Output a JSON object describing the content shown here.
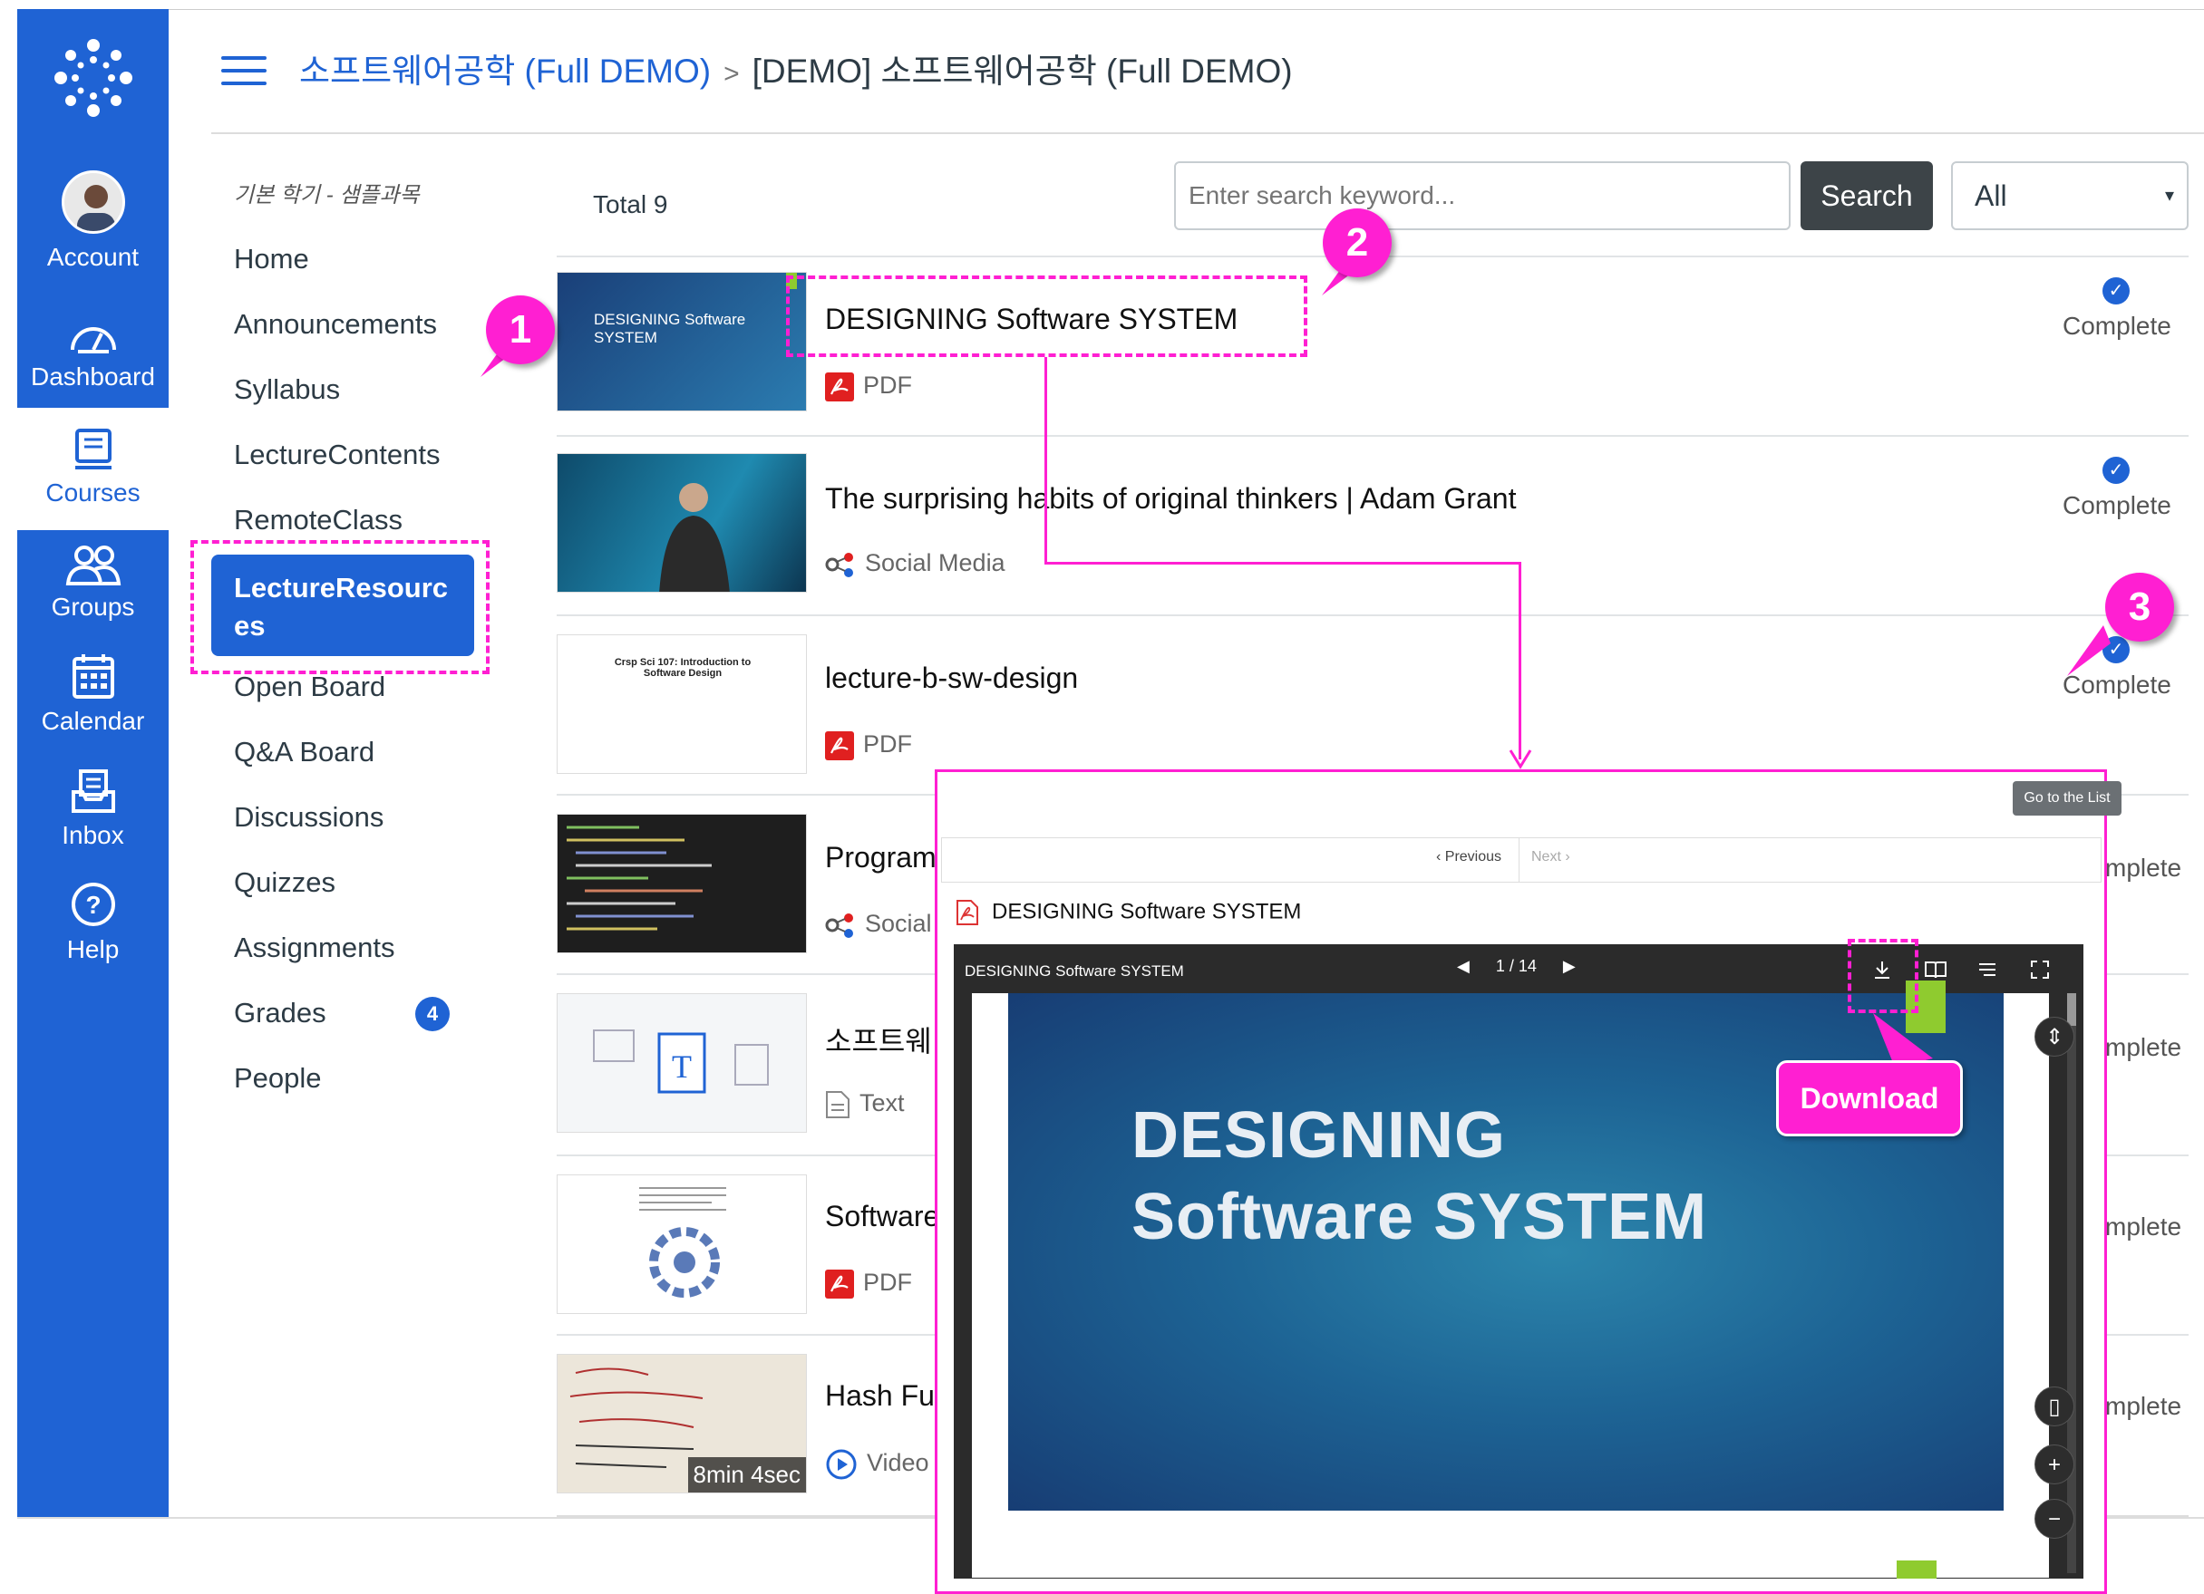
{
  "global_nav": {
    "items": [
      {
        "label": "Account",
        "icon": "avatar"
      },
      {
        "label": "Dashboard",
        "icon": "dashboard-icon"
      },
      {
        "label": "Courses",
        "icon": "courses-icon",
        "active": true
      },
      {
        "label": "Groups",
        "icon": "groups-icon"
      },
      {
        "label": "Calendar",
        "icon": "calendar-icon"
      },
      {
        "label": "Inbox",
        "icon": "inbox-icon"
      },
      {
        "label": "Help",
        "icon": "help-icon"
      }
    ],
    "bg_color": "#1f63d4"
  },
  "header": {
    "breadcrumb_course": "소프트웨어공학 (Full DEMO)",
    "breadcrumb_sep": ">",
    "breadcrumb_current": "[DEMO] 소프트웨어공학 (Full DEMO)"
  },
  "course_nav": {
    "term": "기본 학기 - 샘플과목",
    "items": [
      "Home",
      "Announcements",
      "Syllabus",
      "LectureContents",
      "RemoteClass"
    ],
    "active": "LectureResources",
    "items_after": [
      "Open Board",
      "Q&A Board",
      "Discussions",
      "Quizzes",
      "Assignments",
      "Grades",
      "People"
    ],
    "grades_badge": "4"
  },
  "toolbar": {
    "total": "Total 9",
    "search_placeholder": "Enter search keyword...",
    "search_label": "Search",
    "filter_value": "All",
    "filter_caret": "▾"
  },
  "items": [
    {
      "title": "DESIGNING Software SYSTEM",
      "type": "PDF",
      "status": "Complete",
      "thumb_text": "DESIGNING Software SYSTEM"
    },
    {
      "title": "The surprising habits of original thinkers | Adam Grant",
      "type": "Social Media",
      "status": "Complete"
    },
    {
      "title": "lecture-b-sw-design",
      "type": "PDF",
      "status": "Complete",
      "thumb_text": "Crsp Sci 107: Introduction to Software Design"
    },
    {
      "title": "Program",
      "type": "Social",
      "status": "mplete"
    },
    {
      "title": "소프트웨",
      "type": "Text",
      "status": "mplete"
    },
    {
      "title": "Software",
      "type": "PDF",
      "status": "mplete"
    },
    {
      "title": "Hash Fu",
      "type": "Video",
      "status": "mplete",
      "duration": "8min 4sec"
    }
  ],
  "annotations": {
    "n1": "1",
    "n2": "2",
    "n3": "3",
    "download": "Download",
    "color": "#ff1fd2"
  },
  "viewer": {
    "go_to_list": "Go to the List",
    "previous": "Previous",
    "next": "Next",
    "doc_title": "DESIGNING Software SYSTEM",
    "pdf_bar_title": "DESIGNING Software SYSTEM",
    "page_indicator": "1 / 14",
    "slide_line1": "DESIGNING",
    "slide_line2": "Software SYSTEM"
  }
}
